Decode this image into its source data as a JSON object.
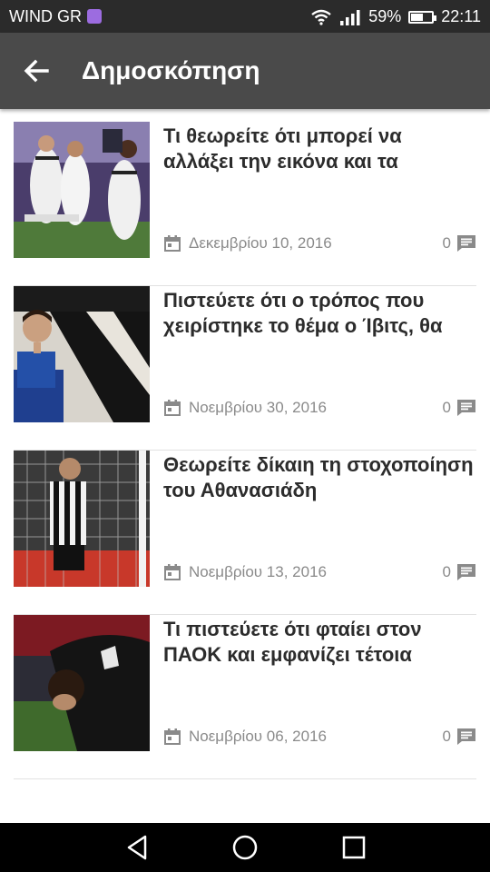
{
  "status_bar": {
    "carrier": "WIND GR",
    "battery": "59%",
    "battery_level": 0.59,
    "time": "22:11"
  },
  "app_bar": {
    "title": "Δημοσκόπηση"
  },
  "polls": [
    {
      "title": "Τι θεωρείτε ότι μπορεί να αλλάξει την εικόνα και τα",
      "date": "Δεκεμβρίου 10, 2016",
      "comments": "0"
    },
    {
      "title": "Πιστεύετε ότι ο τρόπος που χειρίστηκε το θέμα ο Ίβιτς, θα",
      "date": "Νοεμβρίου 30, 2016",
      "comments": "0"
    },
    {
      "title": "Θεωρείτε δίκαιη τη στοχοποίηση του Αθανασιάδη",
      "date": "Νοεμβρίου 13, 2016",
      "comments": "0"
    },
    {
      "title": "Τι πιστεύετε ότι φταίει στον ΠΑΟΚ και εμφανίζει τέτοια",
      "date": "Νοεμβρίου 06, 2016",
      "comments": "0"
    }
  ],
  "icons": {
    "back": "arrow-back-icon",
    "date": "calendar-icon",
    "comments": "comment-icon"
  },
  "colors": {
    "app_bar": "#4a4a4a",
    "status_bar": "#2b2b2b",
    "title_text": "#2c2c2c",
    "meta_text": "#8a8a8a"
  }
}
